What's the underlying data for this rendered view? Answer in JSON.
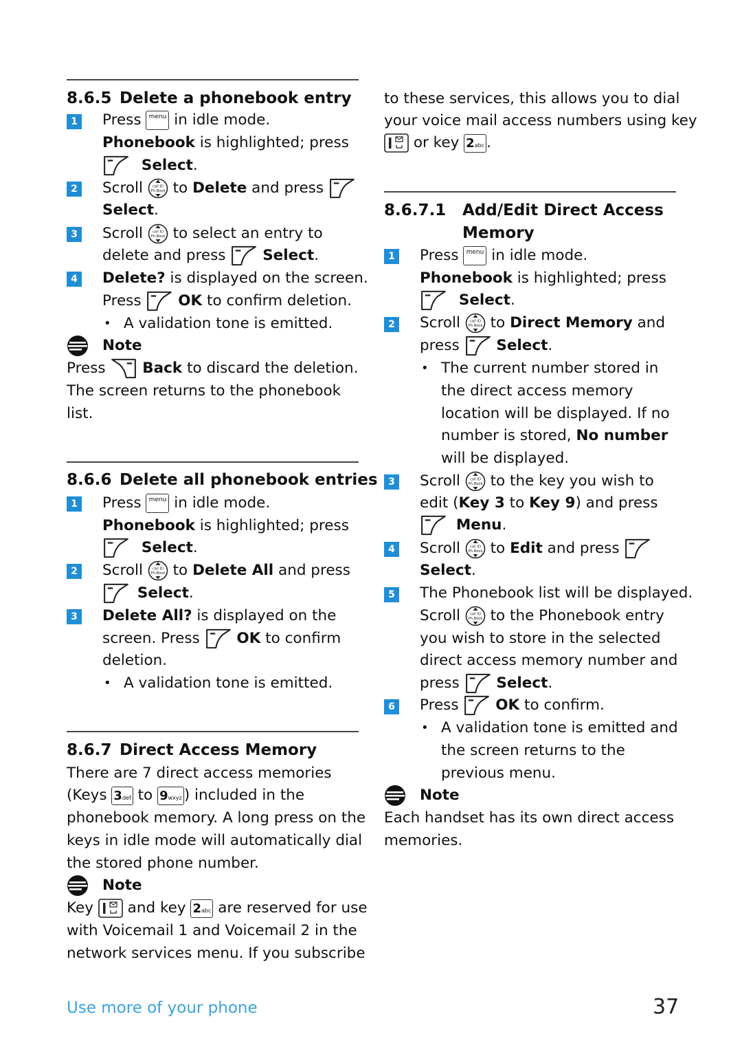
{
  "colors": {
    "step_badge": "#1f8ed6",
    "footer_text": "#3aa3dd",
    "rule": "#444444"
  },
  "icons": {
    "menu_key": "menu",
    "nav_key": {
      "top": "call ID",
      "bottom": "Ph.Book"
    },
    "key_1": {
      "digit": "1",
      "sub": "voicemail"
    },
    "key_2": {
      "digit": "2",
      "sub": "abc"
    },
    "key_3": {
      "digit": "3",
      "sub": "def"
    },
    "key_9": {
      "digit": "9",
      "sub": "wxyz"
    }
  },
  "s865": {
    "num": "8.6.5",
    "title": "Delete a phonebook entry",
    "steps": [
      "1",
      "2",
      "3",
      "4"
    ],
    "l1a": "Press",
    "l1b": "in idle mode.",
    "l2a": "Phonebook",
    "l2b": " is highlighted; press",
    "l3": "Select",
    "l4a": "Scroll",
    "l4b": "to",
    "l4c": "Delete",
    "l4d": "and press",
    "l5": "Select",
    "l6a": "Scroll",
    "l6b": "to select an entry to",
    "l7a": "delete and press",
    "l7b": "Select",
    "l8a": "Delete?",
    "l8b": " is displayed on the screen.",
    "l9a": "Press",
    "l9b": "OK",
    "l9c": " to confirm deletion.",
    "bullet": "A validation tone is emitted.",
    "note_title": "Note",
    "n1a": "Press",
    "n1b": "Back",
    "n1c": " to discard the deletion.",
    "n2": "The screen returns to the phonebook",
    "n3": "list."
  },
  "s866": {
    "num": "8.6.6",
    "title": "Delete all phonebook entries",
    "steps": [
      "1",
      "2",
      "3"
    ],
    "l1a": "Press",
    "l1b": "in idle mode.",
    "l2a": "Phonebook",
    "l2b": " is highlighted; press",
    "l3": "Select",
    "l4a": "Scroll",
    "l4b": "to",
    "l4c": "Delete All",
    "l4d": "and press",
    "l5": "Select",
    "l6a": "Delete All?",
    "l6b": " is displayed on the",
    "l7a": "screen. Press",
    "l7b": "OK",
    "l7c": " to confirm",
    "l8": "deletion.",
    "bullet": "A validation tone is emitted."
  },
  "s867": {
    "num": "8.6.7",
    "title": "Direct Access Memory",
    "p1": "There are 7 direct access memories",
    "p2a": "(Keys",
    "p2b": "to",
    "p2c": ") included in the",
    "p3": "phonebook memory. A long press on the",
    "p4": "keys in idle mode will automatically dial",
    "p5": "the stored phone number.",
    "note_title": "Note",
    "n1a": "Key",
    "n1b": "and key",
    "n1c": "are reserved for use",
    "n2": "with Voicemail 1 and Voicemail 2 in the",
    "n3": "network services menu. If you subscribe",
    "r1": "to these services, this allows you to dial",
    "r2": "your voice mail access numbers using key",
    "r3a": "or key",
    "r3b": "."
  },
  "s8671": {
    "num": "8.6.7.1",
    "title": "Add/Edit Direct Access",
    "title2": "Memory",
    "steps": [
      "1",
      "2",
      "3",
      "4",
      "5",
      "6"
    ],
    "l1a": "Press",
    "l1b": "in idle mode.",
    "l2a": "Phonebook",
    "l2b": " is highlighted; press",
    "l3": "Select",
    "l4a": "Scroll",
    "l4b": "to",
    "l4c": "Direct Memory",
    "l4d": " and",
    "l5a": "press",
    "l5b": "Select",
    "b1": "The current number stored in",
    "b2": "the direct access memory",
    "b3": "location will be displayed. If no",
    "b4a": "number is stored, ",
    "b4b": "No number",
    "b5": "will be displayed.",
    "l6a": "Scroll",
    "l6b": "to the key you wish to",
    "l7a": "edit (",
    "l7b": "Key 3",
    "l7c": " to ",
    "l7d": "Key 9",
    "l7e": ") and press",
    "l8": "Menu",
    "l9a": "Scroll",
    "l9b": "to",
    "l9c": "Edit",
    "l9d": "and press",
    "l10": "Select",
    "l11": "The Phonebook list will be displayed.",
    "l12a": "Scroll",
    "l12b": "to the Phonebook entry",
    "l13": "you wish to store in the selected",
    "l14": "direct access memory number and",
    "l15a": "press",
    "l15b": "Select",
    "l16a": "Press",
    "l16b": "OK",
    "l16c": " to confirm.",
    "c1": "A validation tone is emitted and",
    "c2": "the screen returns to the",
    "c3": "previous menu.",
    "note_title": "Note",
    "n1": "Each handset has its own direct access",
    "n2": "memories."
  },
  "footer": {
    "section": "Use more of your phone",
    "page": "37"
  }
}
